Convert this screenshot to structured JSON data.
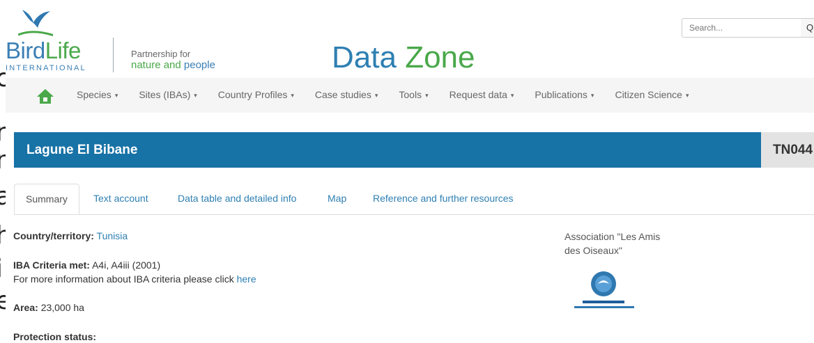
{
  "header": {
    "logo": {
      "name": "BirdLife",
      "name_part1": "Bird",
      "name_part2": "Life",
      "subtitle": "INTERNATIONAL"
    },
    "partnership": {
      "line1": "Partnership for",
      "line2_a": "nature and",
      "line2_b": "people"
    },
    "app_title": {
      "part1": "Data",
      "part2": "Zone"
    },
    "search": {
      "placeholder": "Search...",
      "button_glyph": "Q"
    }
  },
  "nav": {
    "home_icon": "home-icon",
    "items": [
      {
        "label": "Species"
      },
      {
        "label": "Sites (IBAs)"
      },
      {
        "label": "Country Profiles"
      },
      {
        "label": "Case studies"
      },
      {
        "label": "Tools"
      },
      {
        "label": "Request data"
      },
      {
        "label": "Publications"
      },
      {
        "label": "Citizen Science"
      }
    ]
  },
  "site": {
    "name": "Lagune El Bibane",
    "code": "TN044"
  },
  "tabs": [
    {
      "label": "Summary",
      "active": true
    },
    {
      "label": "Text account"
    },
    {
      "label": "Data table and detailed info"
    },
    {
      "label": "Map"
    },
    {
      "label": "Reference and further resources"
    }
  ],
  "summary": {
    "country_label": "Country/territory:",
    "country_value": "Tunisia",
    "criteria_label": "IBA Criteria met:",
    "criteria_value": "A4i, A4iii (2001)",
    "criteria_info_text": "For more information about IBA criteria please click",
    "criteria_info_link": "here",
    "area_label": "Area:",
    "area_value": "23,000 ha",
    "protection_label": "Protection status:"
  },
  "partner": {
    "name_line1": "Association \"Les Amis",
    "name_line2": "des Oiseaux\""
  },
  "colors": {
    "brand_blue": "#1772a6",
    "link_blue": "#2e7fb2",
    "brand_green": "#4aa84a"
  }
}
